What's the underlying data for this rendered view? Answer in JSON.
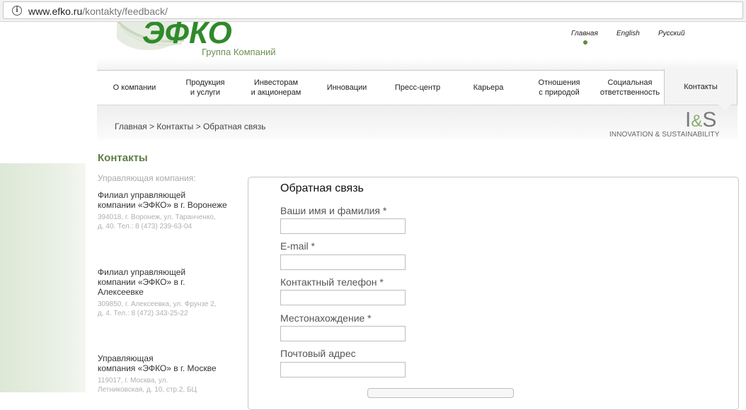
{
  "browser": {
    "url_host": "www.efko.ru",
    "url_path": "/kontakty/feedback/"
  },
  "header": {
    "logo_text": "ЭФКО",
    "logo_subtitle": "Группа Компаний",
    "lang_links": [
      "Главная",
      "English",
      "Русский"
    ]
  },
  "nav": {
    "items": [
      {
        "label": "О компании"
      },
      {
        "label": "Продукция\nи услуги"
      },
      {
        "label": "Инвесторам\nи акционерам"
      },
      {
        "label": "Инновации"
      },
      {
        "label": "Пресс-центр"
      },
      {
        "label": "Карьера"
      },
      {
        "label": "Отношения\nс природой"
      },
      {
        "label": "Социальная\nответственность"
      },
      {
        "label": "Контакты",
        "active": true
      }
    ]
  },
  "breadcrumb": {
    "items": [
      "Главная",
      "Контакты",
      "Обратная связь"
    ],
    "separator": ">"
  },
  "is_logo": {
    "left": "I",
    "amp": "&",
    "right": "S",
    "caption": "INNOVATION & SUSTAINABILITY"
  },
  "sidebar": {
    "title": "Контакты",
    "subtitle": "Управляющая компания:",
    "offices": [
      {
        "name": "Филиал управляющей\nкомпании «ЭФКО» в г. Воронеже",
        "address": "394018, г. Воронеж, ул. Таранченко,\nд. 40. Тел.: 8 (473) 239-63-04"
      },
      {
        "name": "Филиал управляющей\nкомпании «ЭФКО» в г.\nАлексеевке",
        "address": "309850, г. Алексеевка, ул. Фрунзе 2,\nд. 4. Тел.: 8 (472) 343-25-22"
      },
      {
        "name": "Управляющая\nкомпания «ЭФКО» в г. Москве",
        "address": "119017, г. Москва, ул.\nЛетниковская, д. 10, стр.2, БЦ"
      }
    ]
  },
  "form": {
    "title": "Обратная связь",
    "fields": [
      {
        "label": "Ваши имя и фамилия *",
        "value": ""
      },
      {
        "label": "E-mail *",
        "value": ""
      },
      {
        "label": "Контактный телефон *",
        "value": ""
      },
      {
        "label": "Местонахождение *",
        "value": ""
      },
      {
        "label": "Почтовый адрес",
        "value": ""
      }
    ]
  },
  "colors": {
    "brand_green": "#2f8a2a",
    "accent_green": "#5d7d46"
  }
}
